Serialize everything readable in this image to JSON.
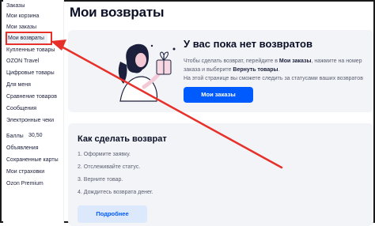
{
  "sidebar": {
    "items": [
      {
        "label": "Заказы"
      },
      {
        "label": "Мои корзина"
      },
      {
        "label": "Мои заказы"
      },
      {
        "label": "Мои возвраты"
      },
      {
        "label": "Купленные товары"
      },
      {
        "label": "OZON Travel"
      },
      {
        "label": "Цифровые товары"
      },
      {
        "label": "Для меня"
      },
      {
        "label": "Сравнение товаров"
      },
      {
        "label": "Сообщения"
      },
      {
        "label": "Электронные чеки"
      },
      {
        "label": "Баллы"
      },
      {
        "label": "Объявления"
      },
      {
        "label": "Сохраненные карты"
      },
      {
        "label": "Мои страховки"
      },
      {
        "label": "Ozon Premium"
      }
    ],
    "balance_value": "30,50"
  },
  "main": {
    "title": "Мои возвраты",
    "empty": {
      "title": "У вас пока нет возвратов",
      "text_1": "Чтобы сделать возврат, перейдите в ",
      "text_link_1": "Мои заказы",
      "text_2": ", нажмите на номер заказа и выберите ",
      "text_link_2": "Вернуть товары",
      "text_3": ".",
      "text_line2": "На этой странице вы сможете следить за статусами ваших возвратов",
      "button": "Мои заказы"
    },
    "how": {
      "title": "Как сделать возврат",
      "steps": [
        "1. Оформите заявку.",
        "2. Отслеживайте статус.",
        "3. Верните товар.",
        "4. Дождитесь возврата денег."
      ],
      "button": "Подробнее"
    }
  },
  "colors": {
    "accent": "#005bff",
    "annotation_red": "#e8302a"
  }
}
